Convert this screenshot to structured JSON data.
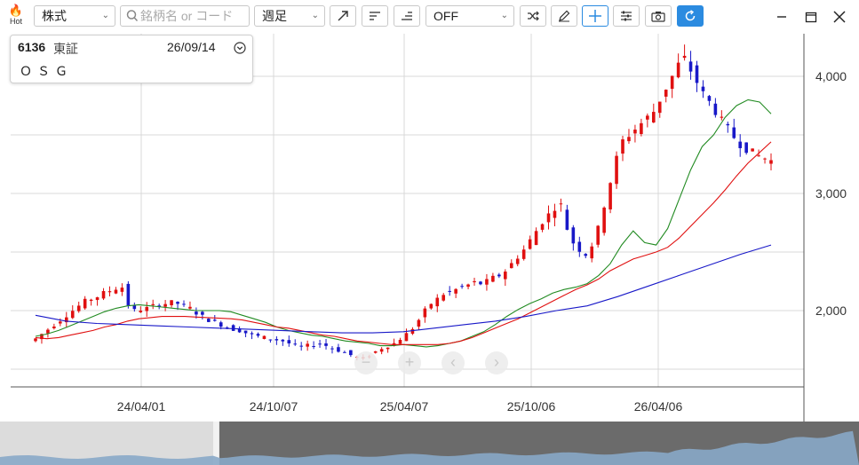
{
  "toolbar": {
    "hot_label": "Hot",
    "asset_type": "株式",
    "search_placeholder": "銘柄名 or コード",
    "period": "週足",
    "overlay": "OFF",
    "accent": "#2b8be0"
  },
  "stock": {
    "code": "6136",
    "market": "東証",
    "date": "26/09/14",
    "name": "ＯＳＧ"
  },
  "chart_data": {
    "type": "candlestick",
    "y_ticks": [
      "2,000",
      "3,000",
      "4,000"
    ],
    "x_ticks": [
      "24/04/01",
      "24/10/07",
      "25/04/07",
      "25/10/06",
      "26/04/06"
    ],
    "ylim": [
      1450,
      4250
    ],
    "series": [
      {
        "color": "#228b22",
        "values": [
          1780,
          1800,
          1830,
          1870,
          1910,
          1950,
          1990,
          2020,
          2040,
          2050,
          2040,
          2030,
          2020,
          2010,
          2000,
          2000,
          2000,
          1990,
          1960,
          1930,
          1900,
          1860,
          1830,
          1810,
          1790,
          1780,
          1760,
          1740,
          1730,
          1720,
          1700,
          1700,
          1710,
          1700,
          1690,
          1700,
          1720,
          1740,
          1780,
          1820,
          1880,
          1950,
          2010,
          2060,
          2100,
          2150,
          2180,
          2200,
          2230,
          2300,
          2400,
          2560,
          2680,
          2580,
          2560,
          2700,
          2950,
          3200,
          3400,
          3500,
          3650,
          3750,
          3800,
          3780,
          3680
        ]
      },
      {
        "color": "#e01010",
        "values": [
          1770,
          1760,
          1770,
          1790,
          1810,
          1830,
          1860,
          1880,
          1910,
          1930,
          1940,
          1950,
          1950,
          1950,
          1945,
          1940,
          1935,
          1930,
          1920,
          1900,
          1880,
          1860,
          1850,
          1830,
          1810,
          1790,
          1780,
          1760,
          1740,
          1730,
          1720,
          1710,
          1710,
          1710,
          1710,
          1710,
          1720,
          1740,
          1770,
          1810,
          1850,
          1890,
          1930,
          1980,
          2030,
          2080,
          2130,
          2180,
          2220,
          2270,
          2340,
          2390,
          2440,
          2470,
          2500,
          2540,
          2620,
          2720,
          2820,
          2920,
          3030,
          3150,
          3260,
          3350,
          3440
        ]
      },
      {
        "color": "#1818c8",
        "values": [
          1960,
          1910,
          1890,
          1880,
          1870,
          1860,
          1850,
          1840,
          1830,
          1820,
          1810,
          1810,
          1820,
          1850,
          1880,
          1910,
          1950,
          2000,
          2040,
          2120,
          2210,
          2300,
          2390,
          2480,
          2560
        ]
      }
    ],
    "candle_count": 151,
    "candle_ohlc_close": [
      1760,
      1800,
      1840,
      1880,
      1920,
      1960,
      2000,
      2040,
      2080,
      2100,
      2120,
      2150,
      2170,
      2190,
      2200,
      2050,
      2000,
      2010,
      2020,
      2040,
      2050,
      2060,
      2070,
      2060,
      2040,
      2020,
      1980,
      1950,
      1920,
      1900,
      1880,
      1860,
      1840,
      1830,
      1810,
      1790,
      1780,
      1770,
      1760,
      1750,
      1740,
      1720,
      1700,
      1690,
      1700,
      1710,
      1720,
      1700,
      1680,
      1660,
      1640,
      1620,
      1600,
      1590,
      1620,
      1650,
      1680,
      1700,
      1720,
      1760,
      1800,
      1850,
      1920,
      2000,
      2060,
      2100,
      2140,
      2160,
      2180,
      2200,
      2220,
      2240,
      2230,
      2250,
      2280,
      2300,
      2340,
      2400,
      2460,
      2520,
      2600,
      2680,
      2760,
      2820,
      2880,
      2900,
      2700,
      2580,
      2520,
      2480,
      2560,
      2700,
      2900,
      3100,
      3300,
      3450,
      3500,
      3550,
      3600,
      3650,
      3700,
      3800,
      3900,
      4000,
      4100,
      4150,
      4050,
      3950,
      3850,
      3780,
      3700,
      3620,
      3550,
      3480,
      3420,
      3380,
      3350,
      3320,
      3300,
      3280
    ]
  }
}
